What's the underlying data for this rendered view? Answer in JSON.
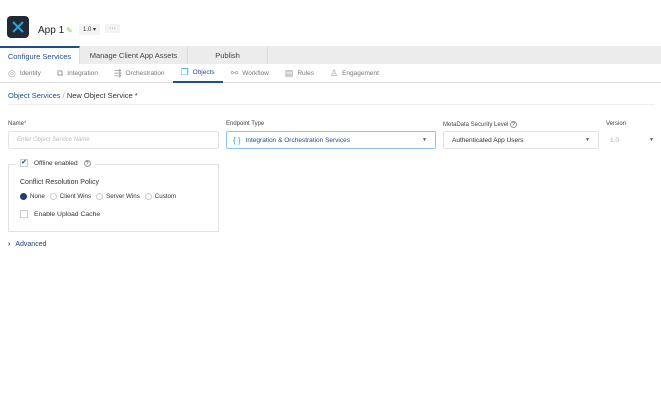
{
  "header": {
    "app_title": "App 1",
    "version": "1.0 ▾",
    "more": "···"
  },
  "tabs": [
    "Configure Services",
    "Manage Client App Assets",
    "Publish"
  ],
  "subtabs": [
    {
      "label": "Identity",
      "icon": "◎"
    },
    {
      "label": "Integration",
      "icon": "⧉"
    },
    {
      "label": "Orchestration",
      "icon": "⇶"
    },
    {
      "label": "Objects",
      "icon": "❐"
    },
    {
      "label": "Workflow",
      "icon": "⚯"
    },
    {
      "label": "Rules",
      "icon": "▤"
    },
    {
      "label": "Engagement",
      "icon": "♙"
    }
  ],
  "breadcrumb": {
    "root": "Object Services",
    "separator": "/",
    "current": "New Object Service *"
  },
  "form": {
    "name_label": "Name",
    "required": "*",
    "name_placeholder": "Enter Object Service Name",
    "endpoint_label": "Endpoint Type",
    "endpoint_icon": "{ }",
    "endpoint_value": "Integration & Orchestration Services",
    "security_label": "MetaData Security Level",
    "help": "?",
    "security_value": "Authenticated App Users",
    "version_label": "Version",
    "version_value": "1.0"
  },
  "offline": {
    "label": "Offline enabled",
    "checked": true,
    "policy_label": "Conflict Resolution Policy",
    "options": [
      "None",
      "Client Wins",
      "Server Wins",
      "Custom"
    ],
    "selected": "None",
    "upload_cache": "Enable Upload Cache"
  },
  "advanced": "Advanced"
}
